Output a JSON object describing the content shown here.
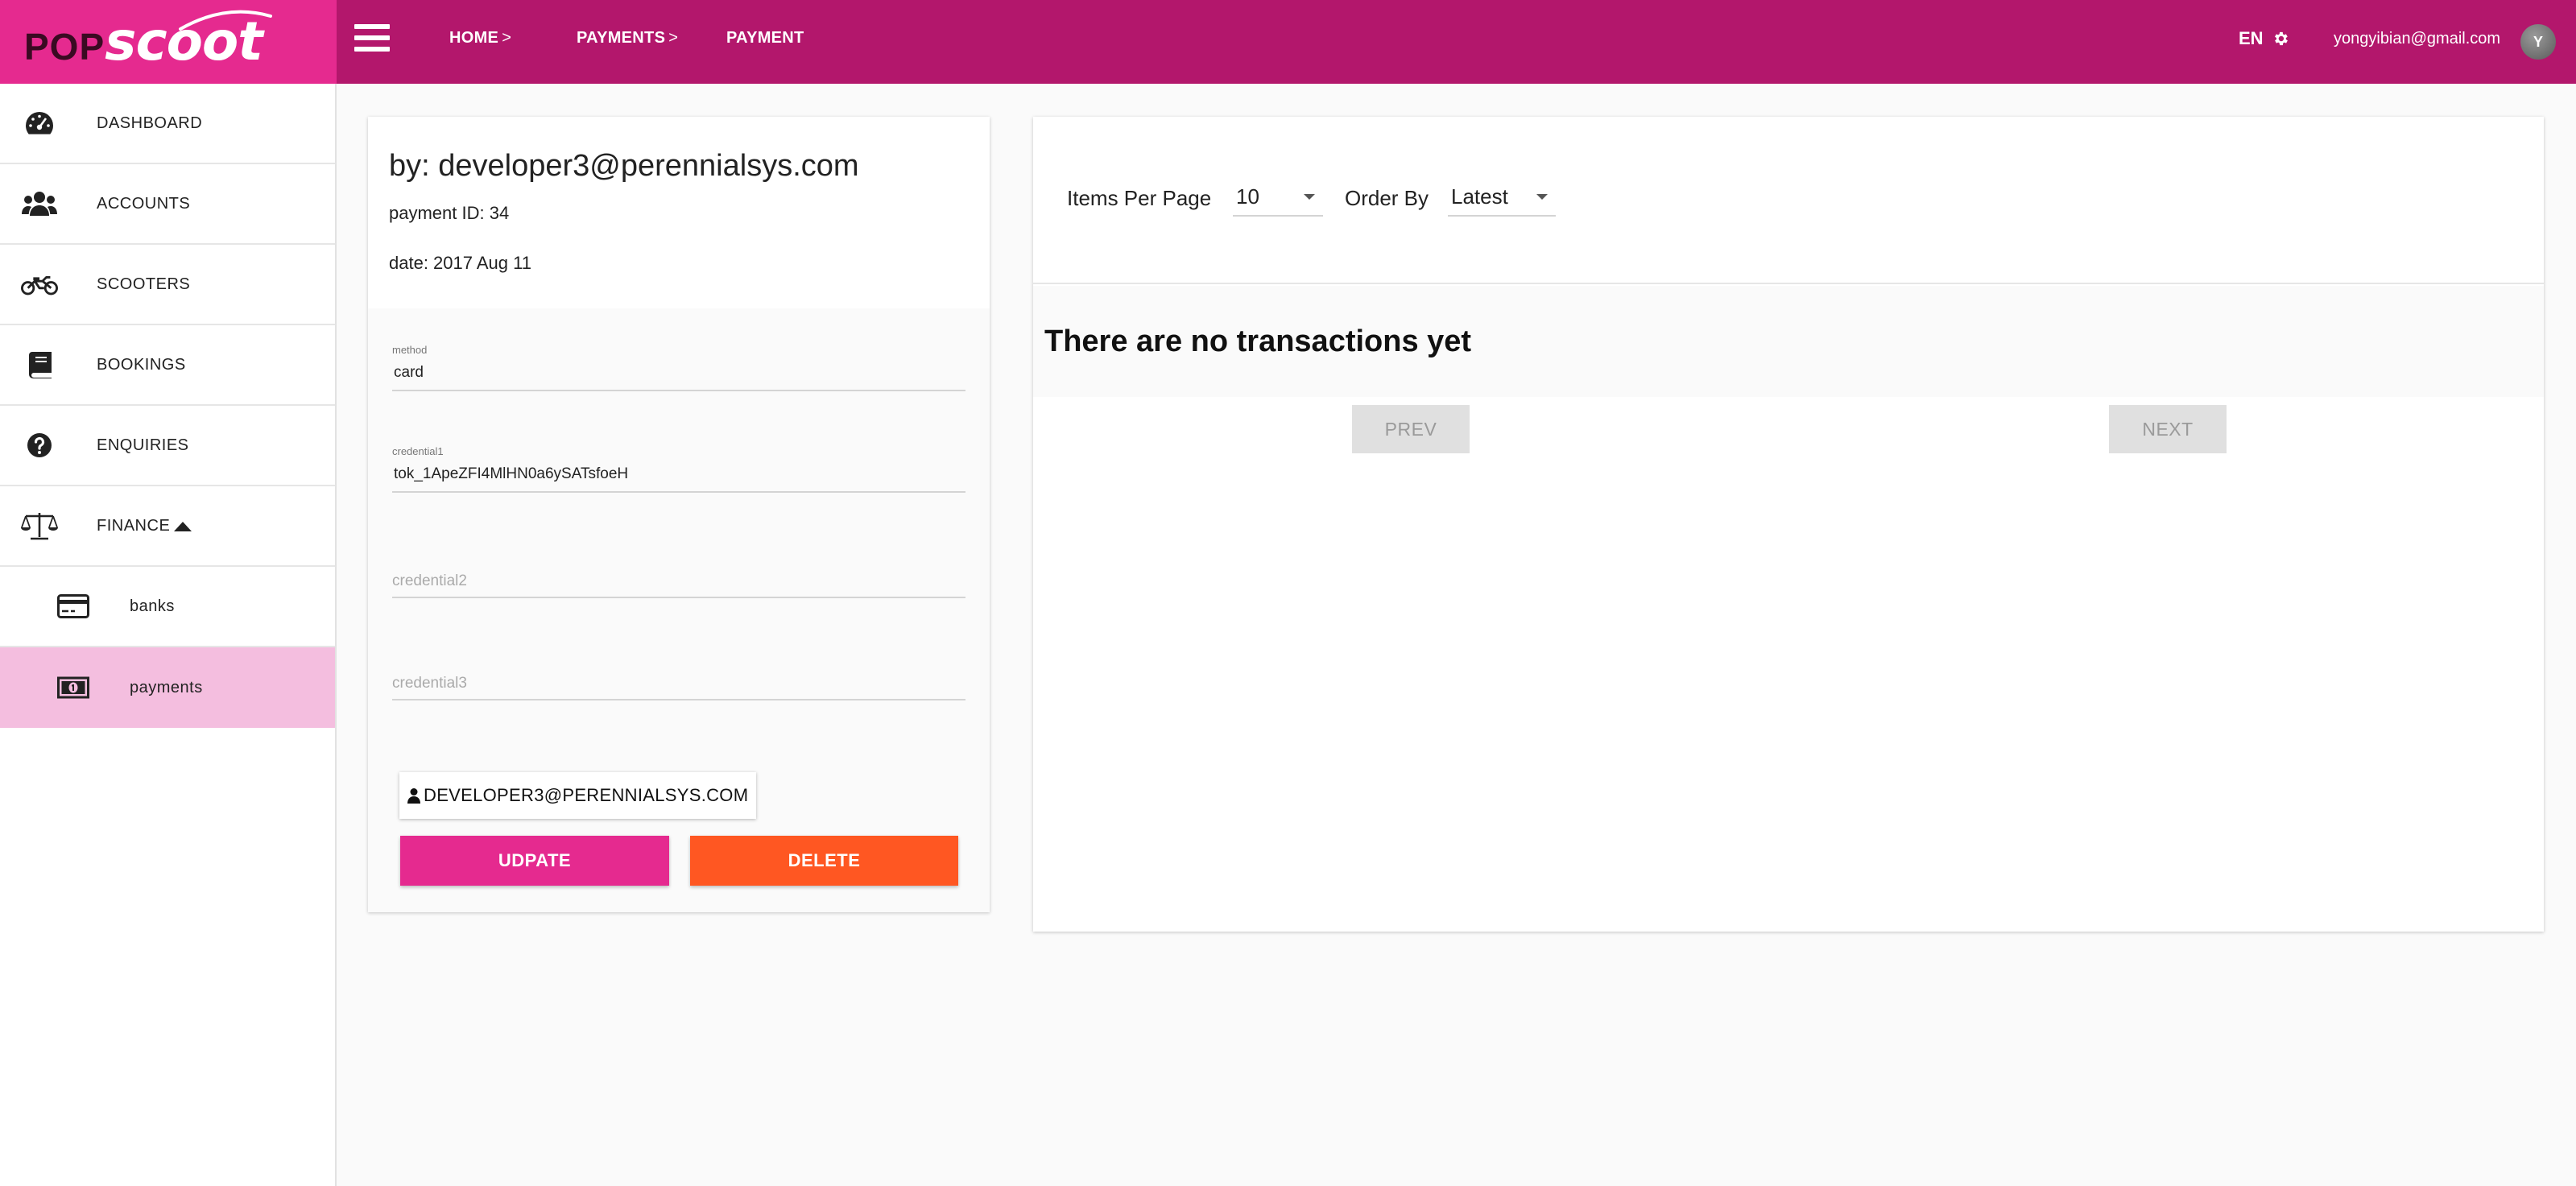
{
  "brand": {
    "logo_left": "POP",
    "logo_right": "scoot"
  },
  "breadcrumb": [
    {
      "label": "HOME",
      "chevron": ">"
    },
    {
      "label": "PAYMENTS",
      "chevron": ">"
    },
    {
      "label": "PAYMENT"
    }
  ],
  "header": {
    "language": "EN",
    "user_email": "yongyibian@gmail.com",
    "avatar_initial": "Y"
  },
  "sidebar": {
    "items": [
      {
        "label": "DASHBOARD",
        "icon": "dashboard-icon"
      },
      {
        "label": "ACCOUNTS",
        "icon": "users-icon"
      },
      {
        "label": "SCOOTERS",
        "icon": "motorcycle-icon"
      },
      {
        "label": "BOOKINGS",
        "icon": "book-icon"
      },
      {
        "label": "ENQUIRIES",
        "icon": "question-icon"
      },
      {
        "label": "FINANCE",
        "icon": "balance-scale-icon",
        "expanded": true
      },
      {
        "label": "banks",
        "icon": "credit-card-icon",
        "sub": true
      },
      {
        "label": "payments",
        "icon": "money-icon",
        "sub": true,
        "active": true
      }
    ]
  },
  "payment": {
    "title": "by: developer3@perennialsys.com",
    "payment_id": "payment ID: 34",
    "date": "date: 2017 Aug 11",
    "fields": {
      "method": {
        "label": "method",
        "value": "card"
      },
      "credential1": {
        "label": "credential1",
        "value": "tok_1ApeZFI4MlHN0a6ySATsfoeH"
      },
      "credential2": {
        "placeholder": "credential2"
      },
      "credential3": {
        "placeholder": "credential3"
      }
    },
    "user_chip": "DEVELOPER3@PERENNIALSYS.COM",
    "update_label": "UDPATE",
    "delete_label": "DELETE"
  },
  "transactions": {
    "items_per_page_label": "Items Per Page",
    "items_per_page_value": "10",
    "order_by_label": "Order By",
    "order_by_value": "Latest",
    "empty_message": "There are no transactions yet",
    "prev_label": "PREV",
    "next_label": "NEXT"
  },
  "colors": {
    "topbar": "#b3176c",
    "logo_bg": "#e52a8f",
    "accent": "#e52a8f",
    "danger": "#ff5722",
    "active_nav": "#f4bedf"
  }
}
